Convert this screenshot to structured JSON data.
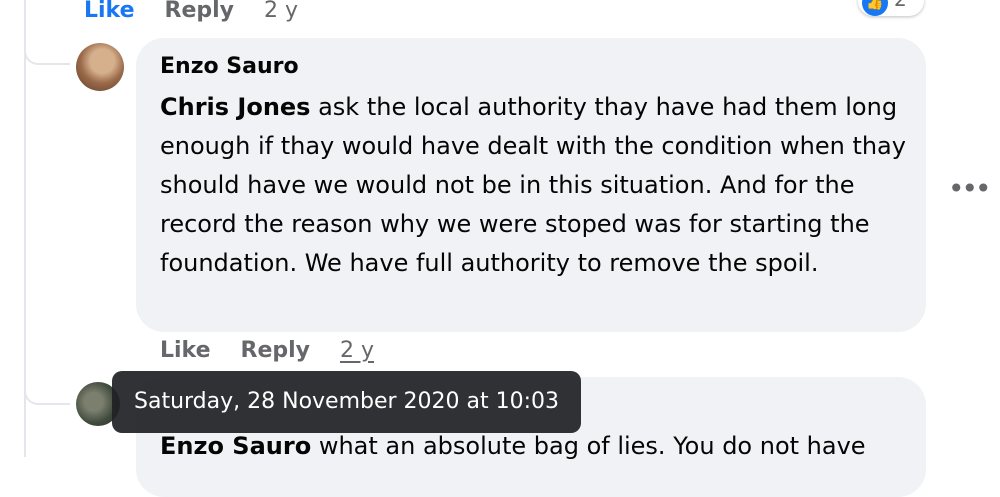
{
  "top_comment_actions": {
    "like": "Like",
    "reply": "Reply",
    "time": "2 y"
  },
  "reaction_badge": {
    "icon": "thumbs-up-icon",
    "count": "2",
    "color": "#1877f2"
  },
  "comment": {
    "author": "Enzo Sauro",
    "mention": "Chris Jones",
    "text": " ask the local authority thay have had them long enough if thay would have dealt with the condition when thay should have we would not be in this situation. And for the record the reason why we were stoped was for starting the foundation. We have full authority to remove the spoil.",
    "actions": {
      "like": "Like",
      "reply": "Reply",
      "time": "2 y"
    }
  },
  "tooltip": {
    "text": "Saturday, 28 November 2020 at 10:03"
  },
  "next_comment": {
    "mention": "Enzo Sauro",
    "text": " what an absolute bag of lies. You do not have"
  }
}
